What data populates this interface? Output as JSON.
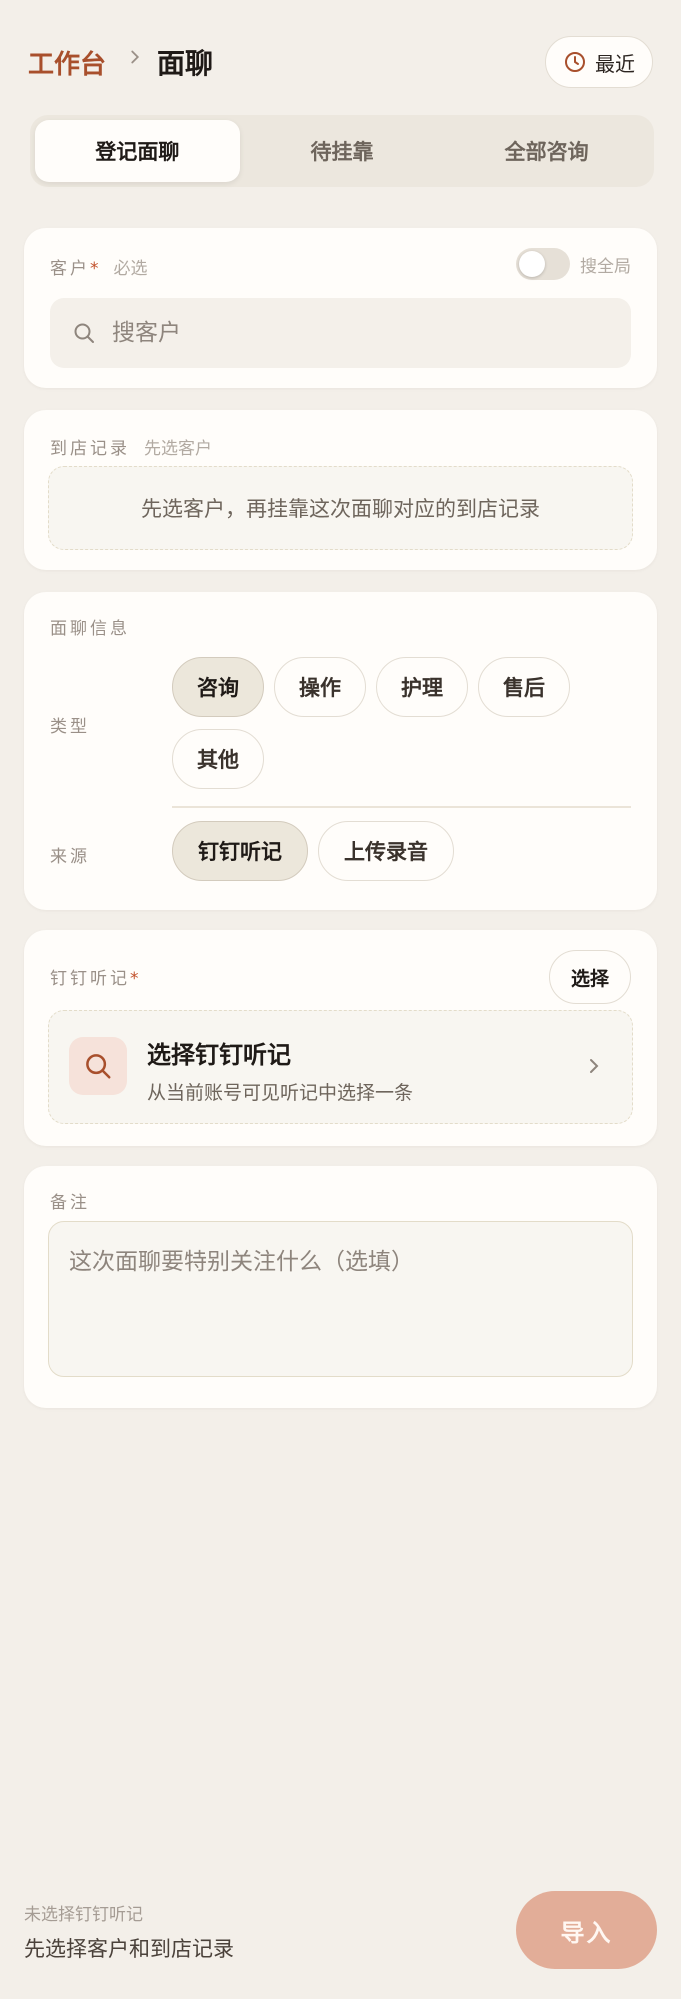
{
  "header": {
    "breadcrumb_root": "工作台",
    "current_page": "面聊",
    "recent_label": "最近"
  },
  "tabs": [
    {
      "label": "登记面聊",
      "active": true
    },
    {
      "label": "待挂靠",
      "active": false
    },
    {
      "label": "全部咨询",
      "active": false
    }
  ],
  "customer": {
    "label": "客户",
    "required_mark": "*",
    "hint": "必选",
    "toggle_label": "搜全局",
    "toggle_on": false,
    "search_placeholder": "搜客户",
    "search_value": ""
  },
  "visit": {
    "label": "到店记录",
    "hint": "先选客户",
    "empty_text": "先选客户，再挂靠这次面聊对应的到店记录"
  },
  "info": {
    "label": "面聊信息",
    "type_label": "类型",
    "types": [
      {
        "label": "咨询",
        "active": true
      },
      {
        "label": "操作",
        "active": false
      },
      {
        "label": "护理",
        "active": false
      },
      {
        "label": "售后",
        "active": false
      },
      {
        "label": "其他",
        "active": false
      }
    ],
    "source_label": "来源",
    "sources": [
      {
        "label": "钉钉听记",
        "active": true
      },
      {
        "label": "上传录音",
        "active": false
      }
    ]
  },
  "dingtalk": {
    "label": "钉钉听记",
    "required_mark": "*",
    "select_button": "选择",
    "picker_title": "选择钉钉听记",
    "picker_subtitle": "从当前账号可见听记中选择一条"
  },
  "notes": {
    "label": "备注",
    "placeholder": "这次面聊要特别关注什么（选填）",
    "value": ""
  },
  "footer": {
    "status_sub": "未选择钉钉听记",
    "status_main": "先选择客户和到店记录",
    "import_button": "导入"
  },
  "colors": {
    "accent": "#a84f2c",
    "background": "#f3efe9",
    "import_button": "#e2ad98"
  }
}
